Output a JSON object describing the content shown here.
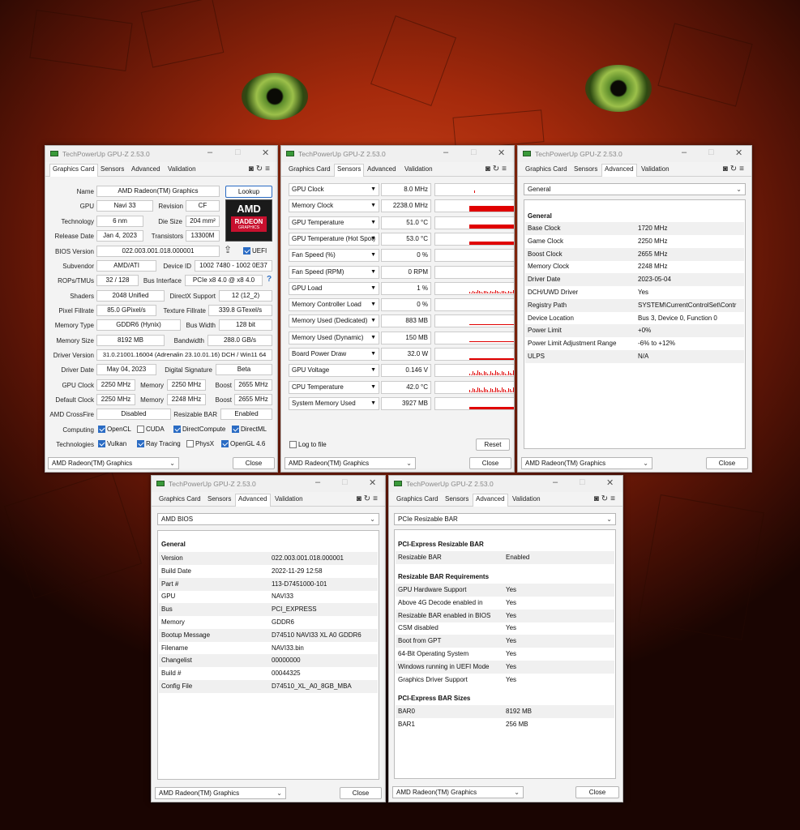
{
  "app_title": "TechPowerUp GPU-Z 2.53.0",
  "tab_labels": [
    "Graphics Card",
    "Sensors",
    "Advanced",
    "Validation"
  ],
  "gpu_select": "AMD Radeon(TM) Graphics",
  "close_label": "Close",
  "graphics_card": {
    "name_label": "Name",
    "name": "AMD Radeon(TM) Graphics",
    "lookup": "Lookup",
    "gpu_label": "GPU",
    "gpu": "Navi 33",
    "revision_label": "Revision",
    "revision": "CF",
    "technology_label": "Technology",
    "technology": "6 nm",
    "die_size_label": "Die Size",
    "die_size": "204 mm²",
    "release_date_label": "Release Date",
    "release_date": "Jan 4, 2023",
    "transistors_label": "Transistors",
    "transistors": "13300M",
    "bios_label": "BIOS Version",
    "bios": "022.003.001.018.000001",
    "uefi": "UEFI",
    "subvendor_label": "Subvendor",
    "subvendor": "AMD/ATI",
    "device_id_label": "Device ID",
    "device_id": "1002 7480 - 1002 0E37",
    "rops_label": "ROPs/TMUs",
    "rops": "32 / 128",
    "bus_interface_label": "Bus Interface",
    "bus_interface": "PCIe x8 4.0 @ x8 4.0",
    "shaders_label": "Shaders",
    "shaders": "2048 Unified",
    "directx_label": "DirectX Support",
    "directx": "12 (12_2)",
    "pixel_fill_label": "Pixel Fillrate",
    "pixel_fill": "85.0 GPixel/s",
    "texture_fill_label": "Texture Fillrate",
    "texture_fill": "339.8 GTexel/s",
    "memory_type_label": "Memory Type",
    "memory_type": "GDDR6 (Hynix)",
    "bus_width_label": "Bus Width",
    "bus_width": "128 bit",
    "memory_size_label": "Memory Size",
    "memory_size": "8192 MB",
    "bandwidth_label": "Bandwidth",
    "bandwidth": "288.0 GB/s",
    "driver_version_label": "Driver Version",
    "driver_version": "31.0.21001.16004 (Adrenalin 23.10.01.16) DCH / Win11 64",
    "driver_date_label": "Driver Date",
    "driver_date": "May 04, 2023",
    "digital_sig_label": "Digital Signature",
    "digital_sig": "Beta",
    "gpu_clock_label": "GPU Clock",
    "gpu_clock": "2250 MHz",
    "memory_label": "Memory",
    "mem_clock": "2250 MHz",
    "boost_label": "Boost",
    "boost": "2655 MHz",
    "default_clock_label": "Default Clock",
    "default_clock": "2250 MHz",
    "def_mem_clock": "2248 MHz",
    "def_boost": "2655 MHz",
    "crossfire_label": "AMD CrossFire",
    "crossfire": "Disabled",
    "rebar_label": "Resizable BAR",
    "rebar": "Enabled",
    "computing_label": "Computing",
    "opencl": "OpenCL",
    "cuda": "CUDA",
    "directcompute": "DirectCompute",
    "directml": "DirectML",
    "technologies_label": "Technologies",
    "vulkan": "Vulkan",
    "raytracing": "Ray Tracing",
    "physx": "PhysX",
    "opengl": "OpenGL 4.6",
    "amd_logo": "AMD",
    "radeon_logo": "RADEON",
    "graphics_logo": "GRAPHICS"
  },
  "sensors": {
    "rows": [
      {
        "name": "GPU Clock",
        "value": "8.0 MHz"
      },
      {
        "name": "Memory Clock",
        "value": "2238.0 MHz"
      },
      {
        "name": "GPU Temperature",
        "value": "51.0 °C"
      },
      {
        "name": "GPU Temperature (Hot Spot)",
        "value": "53.0 °C"
      },
      {
        "name": "Fan Speed (%)",
        "value": "0 %"
      },
      {
        "name": "Fan Speed (RPM)",
        "value": "0 RPM"
      },
      {
        "name": "GPU Load",
        "value": "1 %"
      },
      {
        "name": "Memory Controller Load",
        "value": "0 %"
      },
      {
        "name": "Memory Used (Dedicated)",
        "value": "883 MB"
      },
      {
        "name": "Memory Used (Dynamic)",
        "value": "150 MB"
      },
      {
        "name": "Board Power Draw",
        "value": "32.0 W"
      },
      {
        "name": "GPU Voltage",
        "value": "0.146 V"
      },
      {
        "name": "CPU Temperature",
        "value": "42.0 °C"
      },
      {
        "name": "System Memory Used",
        "value": "3927 MB"
      }
    ],
    "log_to_file": "Log to file",
    "reset": "Reset"
  },
  "adv_general": {
    "select": "General",
    "heading": "General",
    "rows": [
      {
        "k": "Base Clock",
        "v": "1720 MHz"
      },
      {
        "k": "Game Clock",
        "v": "2250 MHz"
      },
      {
        "k": "Boost Clock",
        "v": "2655 MHz"
      },
      {
        "k": "Memory Clock",
        "v": "2248 MHz"
      },
      {
        "k": "Driver Date",
        "v": "2023-05-04"
      },
      {
        "k": "DCH/UWD Driver",
        "v": "Yes"
      },
      {
        "k": "Registry Path",
        "v": "SYSTEM\\CurrentControlSet\\Contr"
      },
      {
        "k": "Device Location",
        "v": "Bus 3, Device 0, Function 0"
      },
      {
        "k": "Power Limit",
        "v": "+0%"
      },
      {
        "k": "Power Limit Adjustment Range",
        "v": "-6% to +12%"
      },
      {
        "k": "ULPS",
        "v": "N/A"
      }
    ]
  },
  "adv_bios": {
    "select": "AMD BIOS",
    "heading": "General",
    "rows": [
      {
        "k": "Version",
        "v": "022.003.001.018.000001"
      },
      {
        "k": "Build Date",
        "v": "2022-11-29 12:58"
      },
      {
        "k": "Part #",
        "v": "113-D7451000-101"
      },
      {
        "k": "GPU",
        "v": "NAVI33"
      },
      {
        "k": "Bus",
        "v": "PCI_EXPRESS"
      },
      {
        "k": "Memory",
        "v": "GDDR6"
      },
      {
        "k": "Bootup Message",
        "v": "D74510 NAVI33 XL A0 GDDR6"
      },
      {
        "k": "Filename",
        "v": "NAVI33.bin"
      },
      {
        "k": "Changelist",
        "v": "00000000"
      },
      {
        "k": "Build #",
        "v": "00044325"
      },
      {
        "k": "Config File",
        "v": "D74510_XL_A0_8GB_MBA"
      }
    ]
  },
  "adv_rebar": {
    "select": "PCIe Resizable BAR",
    "section1": "PCI-Express Resizable BAR",
    "rows1": [
      {
        "k": "Resizable BAR",
        "v": "Enabled"
      }
    ],
    "section2": "Resizable BAR Requirements",
    "rows2": [
      {
        "k": "GPU Hardware Support",
        "v": "Yes"
      },
      {
        "k": "Above 4G Decode enabled in",
        "v": "Yes"
      },
      {
        "k": "Resizable BAR enabled in BIOS",
        "v": "Yes"
      },
      {
        "k": "CSM disabled",
        "v": "Yes"
      },
      {
        "k": "Boot from GPT",
        "v": "Yes"
      },
      {
        "k": "64-Bit Operating System",
        "v": "Yes"
      },
      {
        "k": "Windows running in UEFI Mode",
        "v": "Yes"
      },
      {
        "k": "Graphics Driver Support",
        "v": "Yes"
      }
    ],
    "section3": "PCI-Express BAR Sizes",
    "rows3": [
      {
        "k": "BAR0",
        "v": "8192 MB"
      },
      {
        "k": "BAR1",
        "v": "256 MB"
      }
    ]
  },
  "colors": {
    "graph": "#e00000",
    "checkbox": "#2b6cc4",
    "title_icon": "#3a9a3a"
  }
}
